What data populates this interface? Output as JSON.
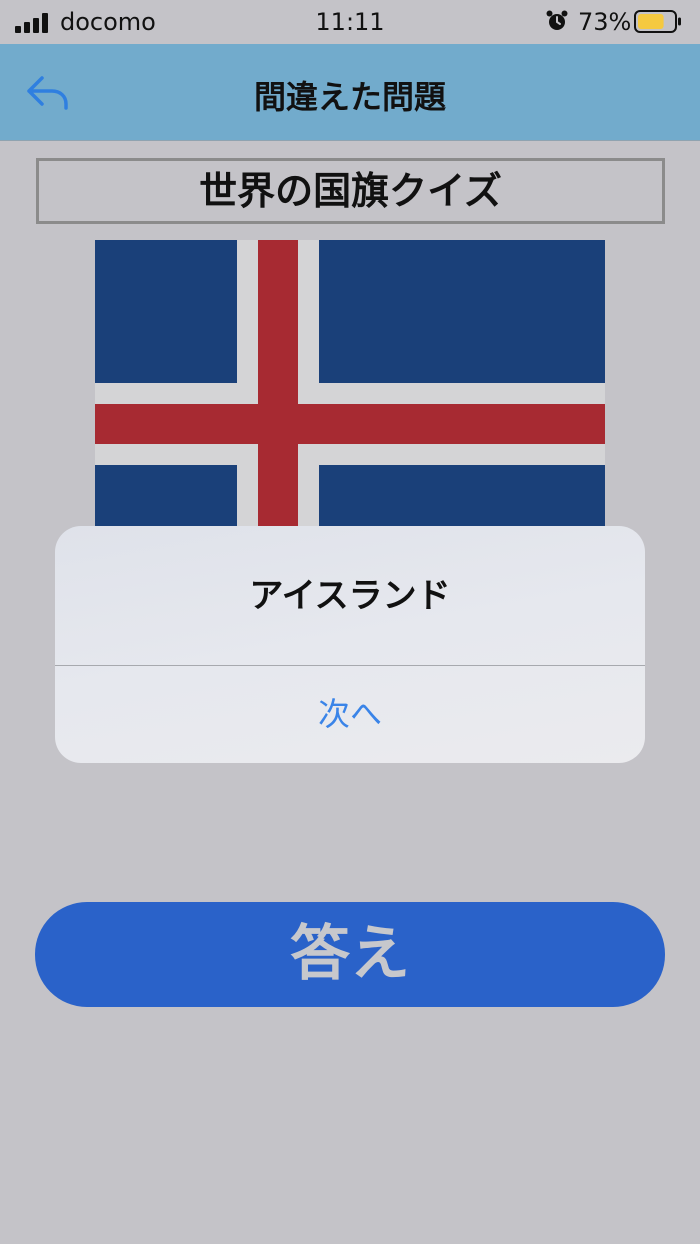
{
  "status_bar": {
    "carrier": "docomo",
    "time": "11:11",
    "battery_percent": "73%",
    "battery_level": 0.73,
    "signal_bars": 4,
    "icons": [
      "signal-icon",
      "alarm-icon",
      "battery-icon"
    ],
    "battery_color": "#f5c940"
  },
  "nav": {
    "title": "間違えた問題",
    "back_icon": "back-arrow-icon",
    "background_color": "#72abcc",
    "accent_color": "#2f7fe0"
  },
  "quiz": {
    "title": "世界の国旗クイズ",
    "flag_colors": {
      "field": "#1a4079",
      "cross_outer": "#d4d4d6",
      "cross_inner": "#a72a32"
    }
  },
  "dialog": {
    "title": "アイスランド",
    "button_label": "次へ",
    "button_color": "#3a84e8"
  },
  "answer_button": {
    "label": "答え",
    "color": "#2a62c9"
  }
}
